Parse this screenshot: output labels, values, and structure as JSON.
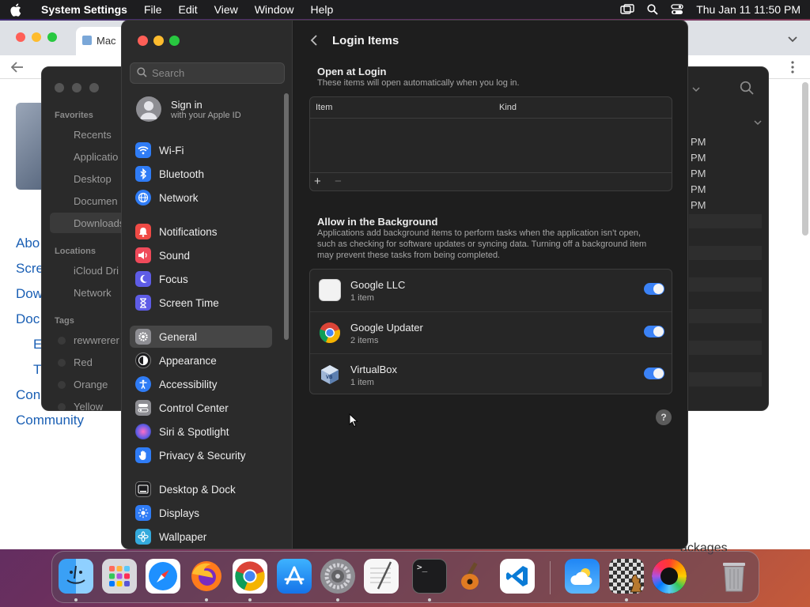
{
  "menubar": {
    "app_name": "System Settings",
    "menus": [
      "File",
      "Edit",
      "View",
      "Window",
      "Help"
    ],
    "clock": "Thu Jan 11  11:50 PM"
  },
  "browser": {
    "tab_title": "Mac",
    "links": [
      "Abo",
      "Scre",
      "Dow",
      "Doc",
      "Con",
      "Community"
    ],
    "bottom_text": "ackages"
  },
  "finder": {
    "favorites_header": "Favorites",
    "favorites": [
      "Recents",
      "Applicatio",
      "Desktop",
      "Documen",
      "Downloads"
    ],
    "locations_header": "Locations",
    "locations": [
      "iCloud Dri",
      "Network"
    ],
    "tags_header": "Tags",
    "tags": [
      "rewwrerer",
      "Red",
      "Orange",
      "Yellow"
    ],
    "times": [
      "PM",
      "PM",
      "PM",
      "PM",
      "PM"
    ]
  },
  "settings": {
    "search_placeholder": "Search",
    "account": {
      "title": "Sign in",
      "subtitle": "with your Apple ID"
    },
    "nav": [
      {
        "label": "Wi-Fi",
        "color": "#2f7cf6"
      },
      {
        "label": "Bluetooth",
        "color": "#2f7cf6"
      },
      {
        "label": "Network",
        "color": "#2f7cf6"
      },
      {
        "label": "Notifications",
        "color": "#ef4a45"
      },
      {
        "label": "Sound",
        "color": "#ef4a5a"
      },
      {
        "label": "Focus",
        "color": "#5e5ce6"
      },
      {
        "label": "Screen Time",
        "color": "#5e5ce6"
      },
      {
        "label": "General",
        "color": "#8e8e93"
      },
      {
        "label": "Appearance",
        "color": "#1c1c1e"
      },
      {
        "label": "Accessibility",
        "color": "#2f7cf6"
      },
      {
        "label": "Control Center",
        "color": "#8e8e93"
      },
      {
        "label": "Siri & Spotlight",
        "color": "#c444d8"
      },
      {
        "label": "Privacy & Security",
        "color": "#2f7cf6"
      },
      {
        "label": "Desktop & Dock",
        "color": "#1c1c1e"
      },
      {
        "label": "Displays",
        "color": "#2f7cf6"
      },
      {
        "label": "Wallpaper",
        "color": "#34aadc"
      }
    ],
    "active_item": "General",
    "content": {
      "title": "Login Items",
      "open_at_login": {
        "title": "Open at Login",
        "subtitle": "These items will open automatically when you log in.",
        "columns": [
          "Item",
          "Kind"
        ],
        "add": "+",
        "remove": "−"
      },
      "background": {
        "title": "Allow in the Background",
        "subtitle": "Applications add background items to perform tasks when the application isn’t open, such as checking for software updates or syncing data. Turning off a background item may prevent these tasks from being completed.",
        "items": [
          {
            "name": "Google LLC",
            "count": "1 item",
            "enabled": true
          },
          {
            "name": "Google Updater",
            "count": "2 items",
            "enabled": true
          },
          {
            "name": "VirtualBox",
            "count": "1 item",
            "enabled": true
          }
        ]
      },
      "help": "?"
    }
  },
  "dock": {
    "apps": [
      "Finder",
      "Launchpad",
      "Safari",
      "Firefox",
      "Chrome",
      "App Store",
      "System Settings",
      "TextEdit",
      "Terminal",
      "GarageBand",
      "Visual Studio Code",
      "Weather",
      "Chess",
      "Color Picker",
      "Trash"
    ],
    "terminal_prompt": ">_"
  },
  "colors": {
    "accent": "#3b82f6",
    "toggle_on": "#3b82f6"
  }
}
